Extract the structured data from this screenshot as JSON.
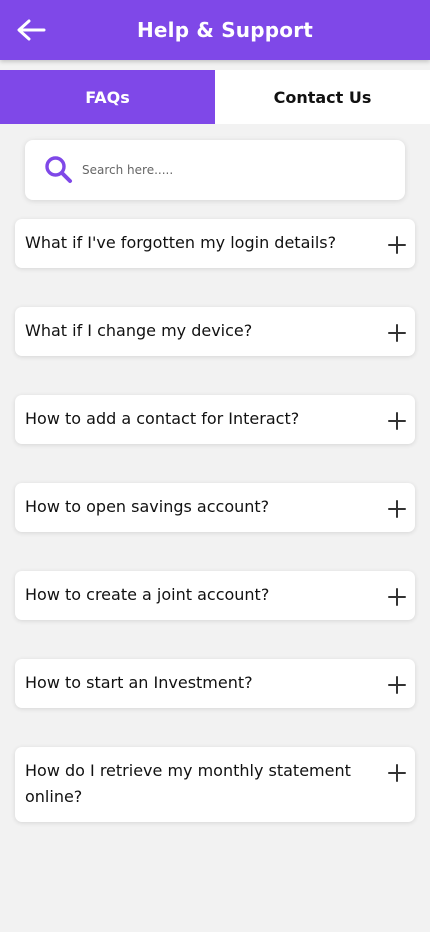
{
  "header": {
    "title": "Help & Support",
    "back_icon": "arrow-left-icon",
    "color": "#7f48e8"
  },
  "tabs": [
    {
      "label": "FAQs",
      "active": true
    },
    {
      "label": "Contact Us",
      "active": false
    }
  ],
  "search": {
    "placeholder": "Search here.....",
    "value": "",
    "icon": "search-icon"
  },
  "faqs": [
    {
      "question": "What if I've forgotten my login details?",
      "icon": "plus-icon"
    },
    {
      "question": "What if I change my device?",
      "icon": "plus-icon"
    },
    {
      "question": "How to add a contact for Interact?",
      "icon": "plus-icon"
    },
    {
      "question": "How to open savings account?",
      "icon": "plus-icon"
    },
    {
      "question": "How to create a joint account?",
      "icon": "plus-icon"
    },
    {
      "question": "How to start an Investment?",
      "icon": "plus-icon"
    },
    {
      "question": "How do I retrieve my monthly statement online?",
      "icon": "plus-icon"
    }
  ],
  "colors": {
    "accent": "#7f48e8",
    "background": "#f2f2f2",
    "card": "#ffffff",
    "text": "#111111"
  }
}
